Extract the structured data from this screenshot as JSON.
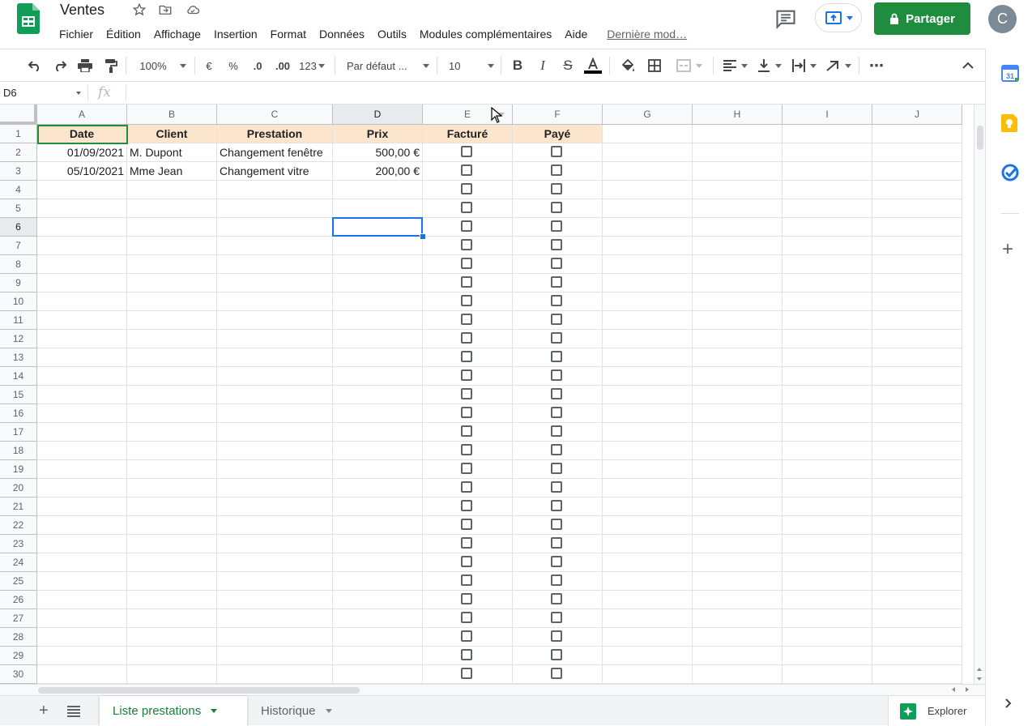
{
  "doc": {
    "title": "Ventes",
    "star_icon": "star-icon",
    "move_icon": "folder-move-icon",
    "cloud_icon": "cloud-saved-icon"
  },
  "menu": [
    "Fichier",
    "Édition",
    "Affichage",
    "Insertion",
    "Format",
    "Données",
    "Outils",
    "Modules complémentaires",
    "Aide"
  ],
  "last_edit": "Dernière mod…",
  "header": {
    "share_label": "Partager",
    "avatar_letter": "C",
    "comment_icon": "comment-icon",
    "present_icon": "present-icon"
  },
  "toolbar": {
    "zoom": "100%",
    "currency": "€",
    "percent": "%",
    "decrease_decimals": ".0",
    "increase_decimals": ".00",
    "number_format": "123",
    "font": "Par défaut ...",
    "font_size": "10",
    "more": "⋯"
  },
  "formula": {
    "name_box": "D6",
    "fx": "fx",
    "value": ""
  },
  "columns": [
    "A",
    "B",
    "C",
    "D",
    "E",
    "F",
    "G",
    "H",
    "I",
    "J"
  ],
  "rows": [
    "1",
    "2",
    "3",
    "4",
    "5",
    "6",
    "7",
    "8",
    "9",
    "10",
    "11",
    "12",
    "13",
    "14",
    "15",
    "16",
    "17",
    "18",
    "19",
    "20",
    "21",
    "22",
    "23",
    "24",
    "25",
    "26",
    "27",
    "28",
    "29",
    "30"
  ],
  "table": {
    "headers": [
      "Date",
      "Client",
      "Prestation",
      "Prix",
      "Facturé",
      "Payé"
    ],
    "data": [
      {
        "date": "01/09/2021",
        "client": "M. Dupont",
        "prestation": "Changement fenêtre",
        "prix": "500,00 €",
        "facture": false,
        "paye": false
      },
      {
        "date": "05/10/2021",
        "client": "Mme Jean",
        "prestation": "Changement vitre",
        "prix": "200,00 €",
        "facture": false,
        "paye": false
      }
    ]
  },
  "selected_cell": "D6",
  "sheets": [
    {
      "label": "Liste prestations",
      "active": true
    },
    {
      "label": "Historique",
      "active": false
    }
  ],
  "explore_label": "Explorer",
  "side_panel": [
    "calendar-icon",
    "keep-icon",
    "tasks-icon",
    "add-icon"
  ],
  "colors": {
    "accent_green": "#1e8e3e",
    "header_fill": "#fce5cd",
    "selection_blue": "#1a73e8"
  }
}
